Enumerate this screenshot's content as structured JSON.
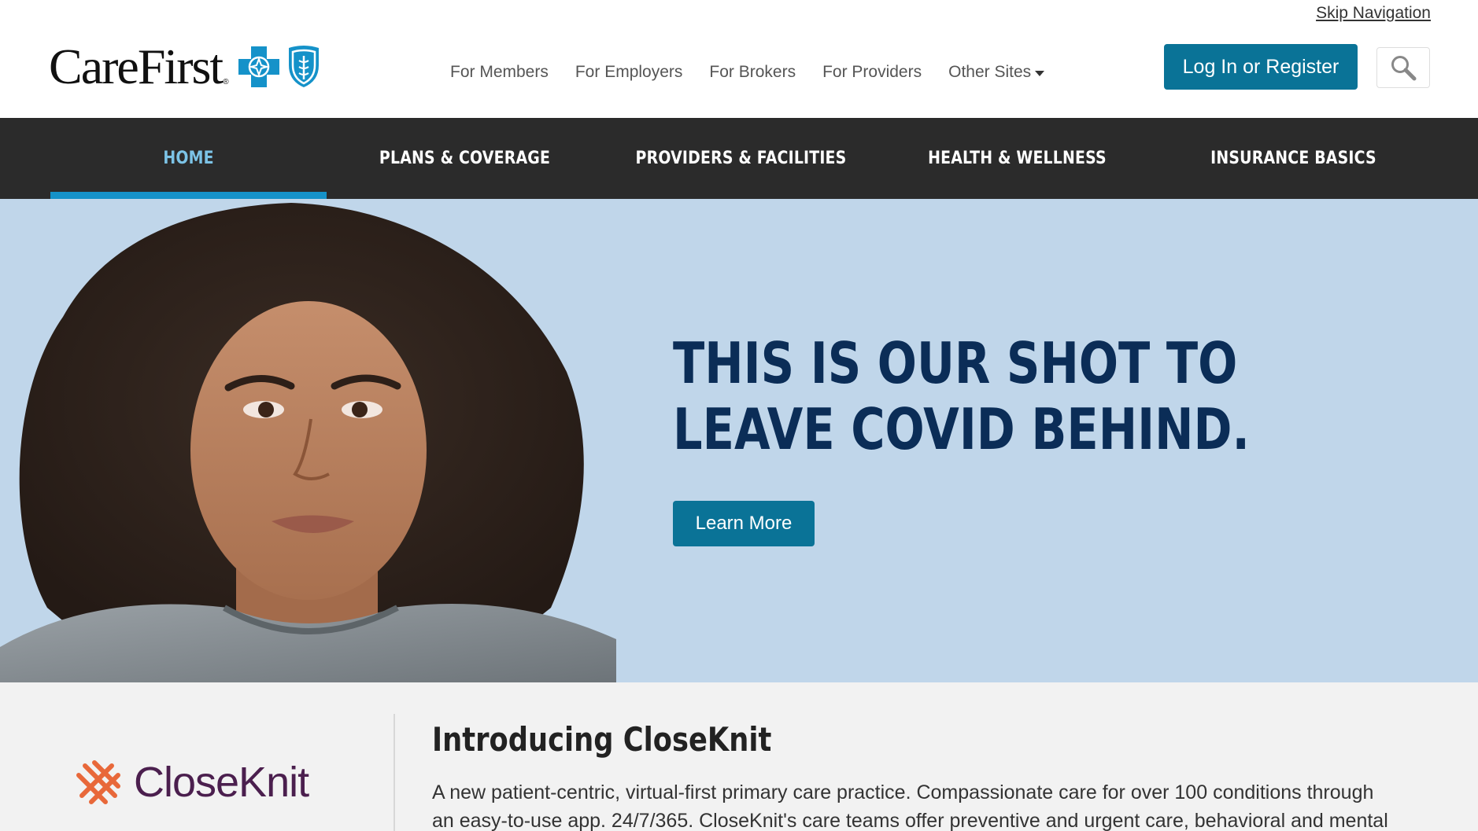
{
  "header": {
    "skip_nav": "Skip Navigation",
    "logo_text": "CareFirst",
    "logo_reg": "®",
    "top_links": [
      {
        "label": "For Members"
      },
      {
        "label": "For Employers"
      },
      {
        "label": "For Brokers"
      },
      {
        "label": "For Providers"
      },
      {
        "label": "Other Sites"
      }
    ],
    "login_label": "Log In or Register",
    "search_icon": "search-icon"
  },
  "nav": {
    "items": [
      {
        "label": "HOME",
        "active": true
      },
      {
        "label": "PLANS & COVERAGE"
      },
      {
        "label": "PROVIDERS & FACILITIES"
      },
      {
        "label": "HEALTH & WELLNESS"
      },
      {
        "label": "INSURANCE BASICS"
      }
    ]
  },
  "hero": {
    "headline_line1": "THIS IS OUR SHOT TO",
    "headline_line2": "LEAVE COVID BEHIND.",
    "cta_label": "Learn More"
  },
  "promo": {
    "logo_text": "CloseKnit",
    "title": "Introducing CloseKnit",
    "body": "A new patient-centric, virtual-first primary care practice. Compassionate care for over 100 conditions through an easy-to-use app. 24/7/365. CloseKnit's care teams offer preventive and urgent care, behavioral and mental"
  },
  "colors": {
    "brand_blue": "#0a7397",
    "nav_bg": "#2b2b2b",
    "nav_active": "#7cc3e6",
    "hero_bg": "#c0d6ea",
    "headline": "#0b2d57",
    "closeknit_purple": "#4b1f4e",
    "closeknit_orange": "#e8683a"
  }
}
